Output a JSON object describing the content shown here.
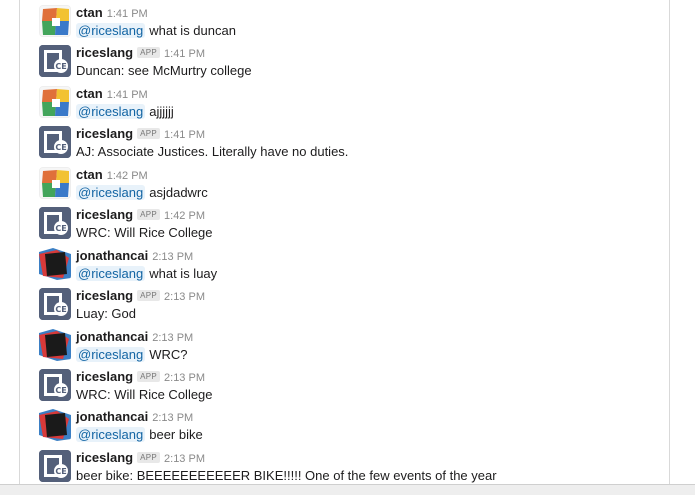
{
  "messages": [
    {
      "sender": "ctan",
      "time": "1:41 PM",
      "mention": "@riceslang",
      "text": "what is duncan"
    },
    {
      "sender": "riceslang",
      "badge": "APP",
      "time": "1:41 PM",
      "text": "Duncan: see McMurtry college"
    },
    {
      "sender": "ctan",
      "time": "1:41 PM",
      "mention": "@riceslang",
      "text": "ajjjjjj"
    },
    {
      "sender": "riceslang",
      "badge": "APP",
      "time": "1:41 PM",
      "text": "AJ: Associate Justices. Literally have no duties."
    },
    {
      "sender": "ctan",
      "time": "1:42 PM",
      "mention": "@riceslang",
      "text": "asjdadwrc"
    },
    {
      "sender": "riceslang",
      "badge": "APP",
      "time": "1:42 PM",
      "text": "WRC: Will Rice College"
    },
    {
      "sender": "jonathancai",
      "time": "2:13 PM",
      "mention": "@riceslang",
      "text": "what is luay"
    },
    {
      "sender": "riceslang",
      "badge": "APP",
      "time": "2:13 PM",
      "text": "Luay: God"
    },
    {
      "sender": "jonathancai",
      "time": "2:13 PM",
      "mention": "@riceslang",
      "text": "WRC?"
    },
    {
      "sender": "riceslang",
      "badge": "APP",
      "time": "2:13 PM",
      "text": "WRC: Will Rice College"
    },
    {
      "sender": "jonathancai",
      "time": "2:13 PM",
      "mention": "@riceslang",
      "text": "beer bike"
    },
    {
      "sender": "riceslang",
      "badge": "APP",
      "time": "2:13 PM",
      "text": "beer bike: BEEEEEEEEEEER BIKE!!!!! One of the few events of the year"
    }
  ],
  "avatars": {
    "ctan": {
      "icon": "ctan-avatar-icon",
      "colors": [
        "#e0703a",
        "#f2c232",
        "#43a55b",
        "#3a79c9",
        "#d94848"
      ]
    },
    "jonathancai": {
      "icon": "jonathancai-avatar-icon",
      "colors": [
        "#1a1a1a",
        "#d83a3a",
        "#3b7fc4"
      ]
    },
    "riceslang": {
      "icon": "riceslang-app-icon",
      "colors": [
        "#54607a",
        "#ffffff"
      ]
    }
  }
}
